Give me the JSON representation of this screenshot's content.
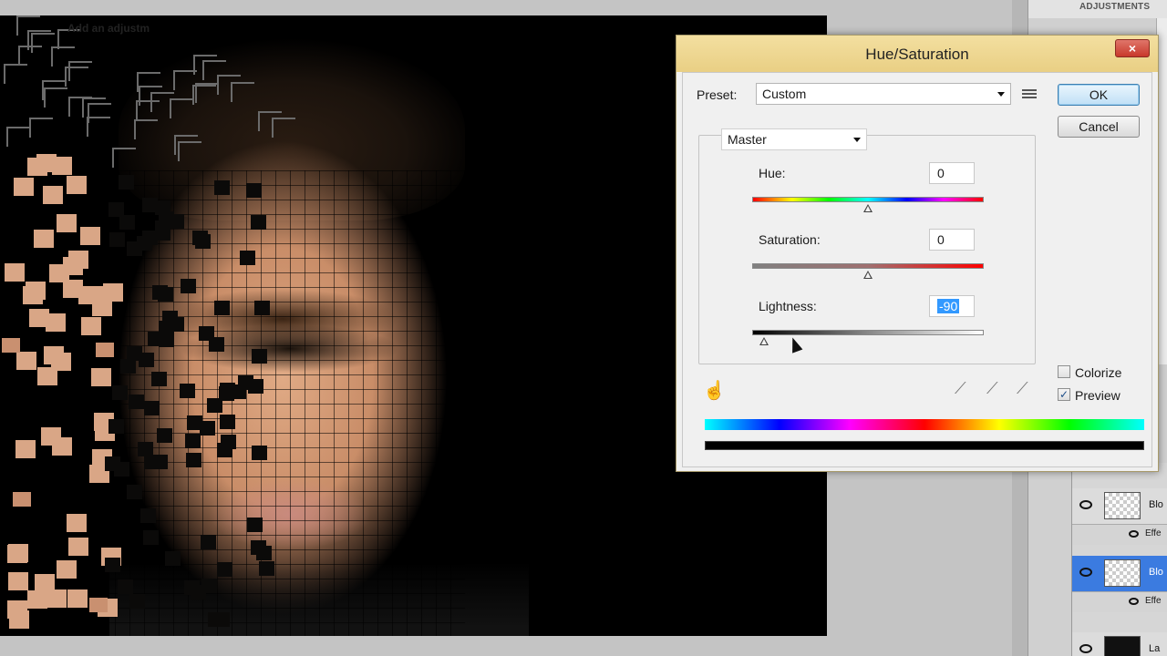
{
  "dialog": {
    "title": "Hue/Saturation",
    "close_label": "×",
    "preset_label": "Preset:",
    "preset_value": "Custom",
    "ok_label": "OK",
    "cancel_label": "Cancel",
    "channel_value": "Master",
    "hue": {
      "label": "Hue:",
      "value": "0",
      "slider_fraction": 0.5
    },
    "saturation": {
      "label": "Saturation:",
      "value": "0",
      "slider_fraction": 0.5
    },
    "lightness": {
      "label": "Lightness:",
      "value": "-90",
      "slider_fraction": 0.05
    },
    "colorize_label": "Colorize",
    "colorize_checked": false,
    "preview_label": "Preview",
    "preview_checked": true,
    "check_mark": "✓"
  },
  "right_panel": {
    "header": "ADJUSTMENTS",
    "subtitle": "Add an adjustm"
  },
  "layers": {
    "rows": [
      {
        "name": "Blo",
        "selected": false
      },
      {
        "name": "Blo",
        "selected": true
      },
      {
        "name": "La",
        "selected": false
      }
    ],
    "effects_label": "Effe"
  },
  "icons": {
    "preset_menu": "list-menu-icon",
    "hand_tool": "targeted-adjustment-hand-icon",
    "eyedropper": "eyedropper-icon",
    "eyedropper_plus": "eyedropper-plus-icon",
    "eyedropper_minus": "eyedropper-minus-icon",
    "close": "close-icon",
    "eye": "visibility-eye-icon"
  },
  "colors": {
    "title_bar": "#ecd38c",
    "selection_blue": "#3399ff",
    "ok_button_border": "#3c7fb1",
    "layer_selected": "#3b7be0"
  }
}
